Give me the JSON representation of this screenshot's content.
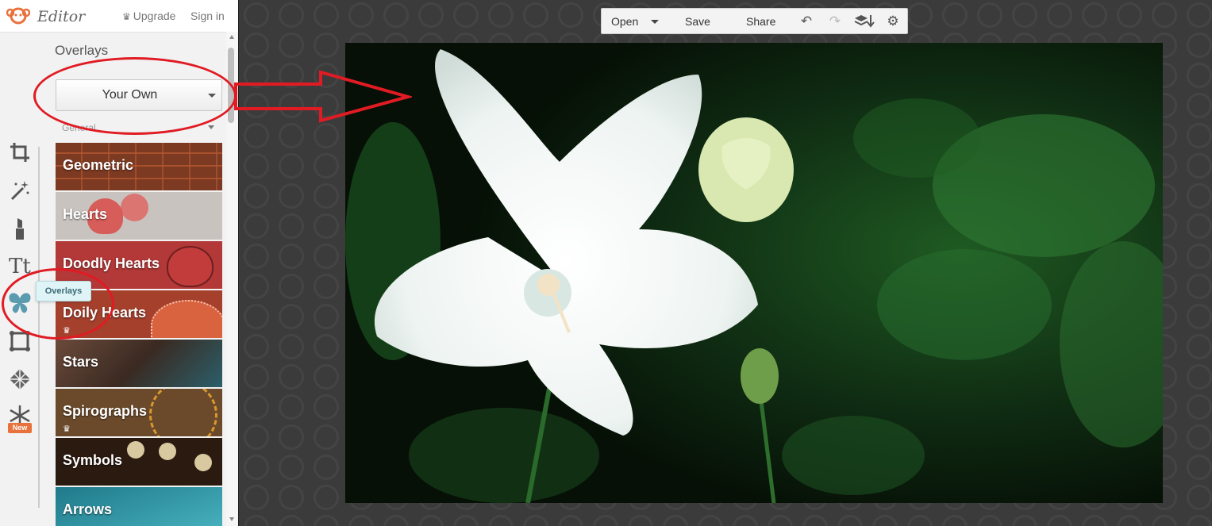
{
  "app": {
    "brand": "Editor",
    "upgrade": "Upgrade",
    "sign_in": "Sign in"
  },
  "rail": [
    {
      "name": "crop-icon",
      "tip": ""
    },
    {
      "name": "effects-wand-icon",
      "tip": ""
    },
    {
      "name": "touch-up-lipstick-icon",
      "tip": ""
    },
    {
      "name": "text-icon",
      "tip": ""
    },
    {
      "name": "butterfly-overlays-icon",
      "tip": "Overlays"
    },
    {
      "name": "frame-icon",
      "tip": ""
    },
    {
      "name": "texture-icon",
      "tip": ""
    },
    {
      "name": "snowflake-icon",
      "tip": ""
    }
  ],
  "rail_new_badge": "New",
  "panel": {
    "title": "Overlays",
    "your_own": "Your Own",
    "category": "General"
  },
  "overlays": [
    {
      "label": "Geometric",
      "premium": false,
      "color": "#8a3f24"
    },
    {
      "label": "Hearts",
      "premium": false,
      "color": "#c9c3c0"
    },
    {
      "label": "Doodly Hearts",
      "premium": false,
      "color": "#b33838"
    },
    {
      "label": "Doily Hearts",
      "premium": true,
      "color": "#a5402d"
    },
    {
      "label": "Stars",
      "premium": false,
      "color": "#5a3a2a"
    },
    {
      "label": "Spirographs",
      "premium": true,
      "color": "#6a4a2a"
    },
    {
      "label": "Symbols",
      "premium": false,
      "color": "#2a1a10"
    },
    {
      "label": "Arrows",
      "premium": false,
      "color": "#2a8fa0"
    }
  ],
  "tooltip": "Overlays",
  "toolbar": {
    "open": "Open",
    "save": "Save",
    "share": "Share"
  },
  "colors": {
    "annotation": "#e01b23",
    "tooltip_bg": "#dff4f7"
  }
}
